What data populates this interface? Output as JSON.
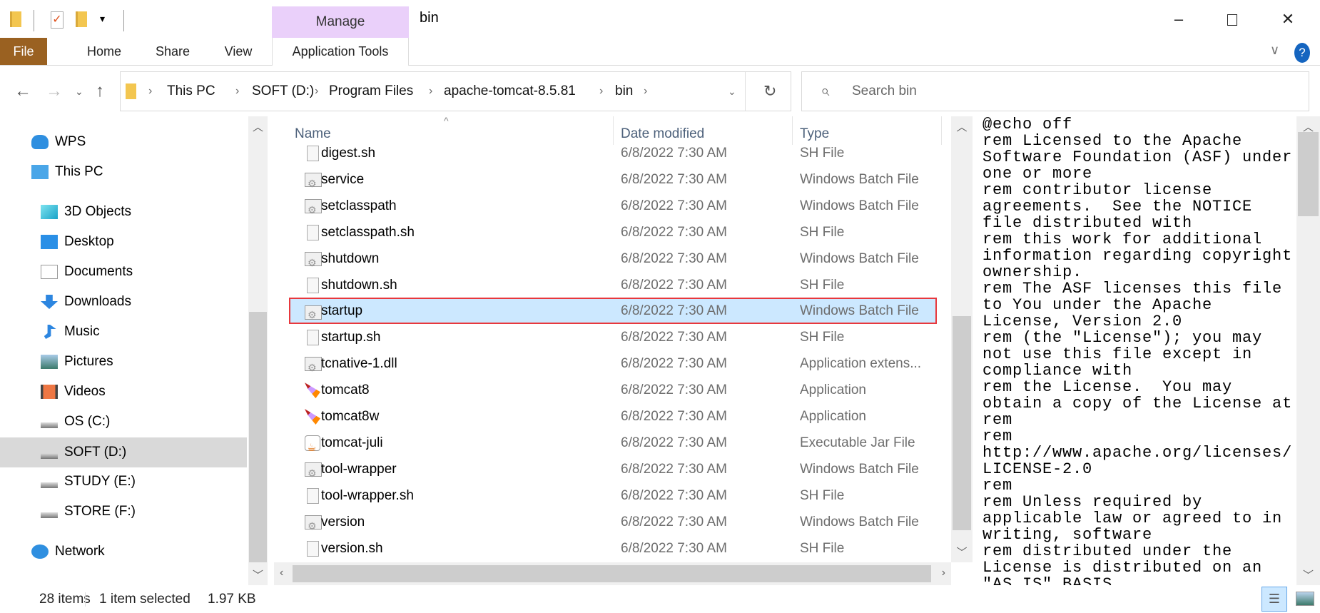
{
  "window": {
    "title": "bin"
  },
  "quick_access": {
    "items": [
      "folder-icon",
      "properties-icon",
      "new-folder-icon",
      "customize-dropdown"
    ]
  },
  "ribbon": {
    "context_group": "Manage",
    "tabs": [
      {
        "label": "File"
      },
      {
        "label": "Home"
      },
      {
        "label": "Share"
      },
      {
        "label": "View"
      },
      {
        "label": "Application Tools"
      }
    ]
  },
  "address": {
    "breadcrumb": [
      "This PC",
      "SOFT (D:)",
      "Program Files",
      "apache-tomcat-8.5.81",
      "bin"
    ]
  },
  "search": {
    "placeholder": "Search bin"
  },
  "nav": {
    "items": [
      {
        "label": "WPS",
        "icon": "cloud-icon",
        "level": 0
      },
      {
        "label": "This PC",
        "icon": "computer-icon",
        "level": 0
      },
      {
        "label": "3D Objects",
        "icon": "cube-icon",
        "level": 1
      },
      {
        "label": "Desktop",
        "icon": "desktop-icon",
        "level": 1
      },
      {
        "label": "Documents",
        "icon": "documents-icon",
        "level": 1
      },
      {
        "label": "Downloads",
        "icon": "download-icon",
        "level": 1
      },
      {
        "label": "Music",
        "icon": "music-icon",
        "level": 1
      },
      {
        "label": "Pictures",
        "icon": "pictures-icon",
        "level": 1
      },
      {
        "label": "Videos",
        "icon": "videos-icon",
        "level": 1
      },
      {
        "label": "OS (C:)",
        "icon": "drive-icon",
        "level": 1
      },
      {
        "label": "SOFT (D:)",
        "icon": "drive-icon",
        "level": 1,
        "selected": true
      },
      {
        "label": "STUDY (E:)",
        "icon": "drive-icon",
        "level": 1
      },
      {
        "label": "STORE (F:)",
        "icon": "drive-icon",
        "level": 1
      },
      {
        "label": "Network",
        "icon": "network-icon",
        "level": 0
      }
    ]
  },
  "list": {
    "columns": {
      "name": "Name",
      "date": "Date modified",
      "type": "Type"
    },
    "files": [
      {
        "name": "digest.sh",
        "date": "6/8/2022 7:30 AM",
        "type": "SH File",
        "icon": "blank"
      },
      {
        "name": "service",
        "date": "6/8/2022 7:30 AM",
        "type": "Windows Batch File",
        "icon": "gear"
      },
      {
        "name": "setclasspath",
        "date": "6/8/2022 7:30 AM",
        "type": "Windows Batch File",
        "icon": "gear"
      },
      {
        "name": "setclasspath.sh",
        "date": "6/8/2022 7:30 AM",
        "type": "SH File",
        "icon": "blank"
      },
      {
        "name": "shutdown",
        "date": "6/8/2022 7:30 AM",
        "type": "Windows Batch File",
        "icon": "gear"
      },
      {
        "name": "shutdown.sh",
        "date": "6/8/2022 7:30 AM",
        "type": "SH File",
        "icon": "blank"
      },
      {
        "name": "startup",
        "date": "6/8/2022 7:30 AM",
        "type": "Windows Batch File",
        "icon": "gear",
        "selected": true
      },
      {
        "name": "startup.sh",
        "date": "6/8/2022 7:30 AM",
        "type": "SH File",
        "icon": "blank"
      },
      {
        "name": "tcnative-1.dll",
        "date": "6/8/2022 7:30 AM",
        "type": "Application extens...",
        "icon": "gear"
      },
      {
        "name": "tomcat8",
        "date": "6/8/2022 7:30 AM",
        "type": "Application",
        "icon": "tomcat"
      },
      {
        "name": "tomcat8w",
        "date": "6/8/2022 7:30 AM",
        "type": "Application",
        "icon": "tomcat"
      },
      {
        "name": "tomcat-juli",
        "date": "6/8/2022 7:30 AM",
        "type": "Executable Jar File",
        "icon": "jar"
      },
      {
        "name": "tool-wrapper",
        "date": "6/8/2022 7:30 AM",
        "type": "Windows Batch File",
        "icon": "gear"
      },
      {
        "name": "tool-wrapper.sh",
        "date": "6/8/2022 7:30 AM",
        "type": "SH File",
        "icon": "blank"
      },
      {
        "name": "version",
        "date": "6/8/2022 7:30 AM",
        "type": "Windows Batch File",
        "icon": "gear"
      },
      {
        "name": "version.sh",
        "date": "6/8/2022 7:30 AM",
        "type": "SH File",
        "icon": "blank"
      }
    ]
  },
  "preview": {
    "lines": [
      "@echo off",
      "rem Licensed to the Apache",
      "Software Foundation (ASF) under",
      "one or more",
      "rem contributor license",
      "agreements.  See the NOTICE",
      "file distributed with",
      "rem this work for additional",
      "information regarding copyright",
      "ownership.",
      "rem The ASF licenses this file",
      "to You under the Apache",
      "License, Version 2.0",
      "rem (the \"License\"); you may",
      "not use this file except in",
      "compliance with",
      "rem the License.  You may",
      "obtain a copy of the License at",
      "rem",
      "rem",
      "http://www.apache.org/licenses/",
      "LICENSE-2.0",
      "rem",
      "rem Unless required by",
      "applicable law or agreed to in",
      "writing, software",
      "rem distributed under the",
      "License is distributed on an",
      "\"AS IS\" BASIS,"
    ]
  },
  "status": {
    "items_count": "28 items",
    "selection": "1 item selected",
    "size": "1.97 KB"
  },
  "colors": {
    "file_tab": "#9a6121",
    "manage_tab": "#ead0fa",
    "selection": "#cce8ff",
    "highlight_border": "#e8383d"
  }
}
